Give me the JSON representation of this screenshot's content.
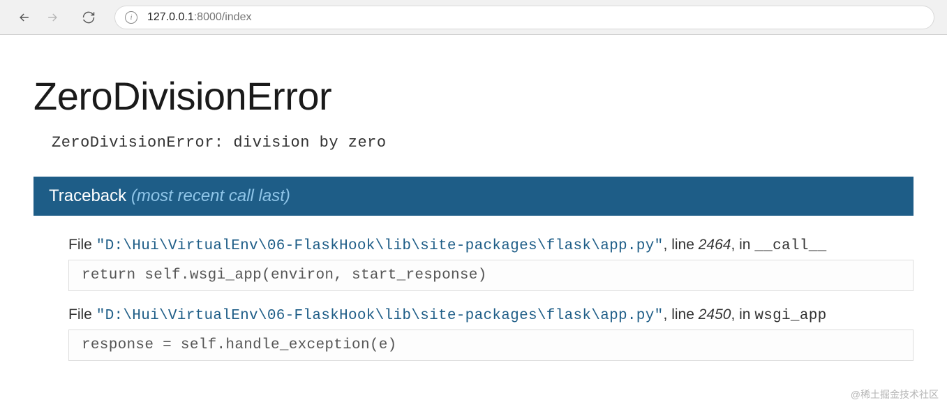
{
  "browser": {
    "url_host": "127.0.0.1",
    "url_port_path": ":8000/index"
  },
  "error": {
    "title": "ZeroDivisionError",
    "message": "ZeroDivisionError: division by zero"
  },
  "traceback": {
    "label": "Traceback ",
    "suffix": "(most recent call last)",
    "frames": [
      {
        "file_prefix": "File ",
        "file_path": "\"D:\\Hui\\VirtualEnv\\06-FlaskHook\\lib\\site-packages\\flask\\app.py\"",
        "line_prefix": ", line ",
        "line_num": "2464",
        "in_prefix": ", in ",
        "func": "__call__",
        "code": "return self.wsgi_app(environ, start_response)"
      },
      {
        "file_prefix": "File ",
        "file_path": "\"D:\\Hui\\VirtualEnv\\06-FlaskHook\\lib\\site-packages\\flask\\app.py\"",
        "line_prefix": ", line ",
        "line_num": "2450",
        "in_prefix": ", in ",
        "func": "wsgi_app",
        "code": "response = self.handle_exception(e)"
      }
    ]
  },
  "watermark": "@稀土掘金技术社区"
}
